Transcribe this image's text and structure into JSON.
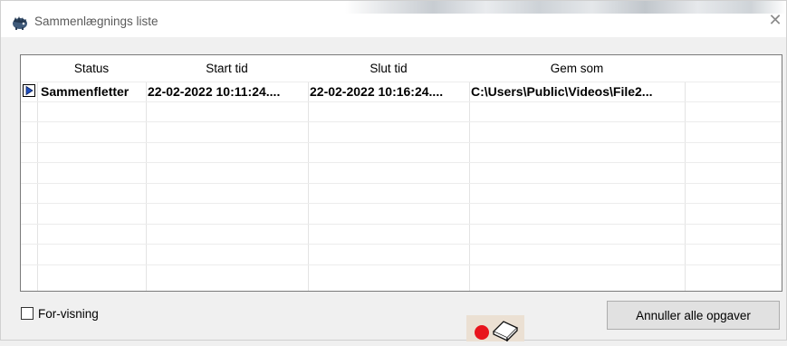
{
  "window": {
    "title": "Sammenlægnings liste",
    "close_glyph": "✕",
    "app_icon": "hedgehog-app-icon"
  },
  "list": {
    "columns": [
      "Status",
      "Start tid",
      "Slut tid",
      "Gem som",
      ""
    ],
    "rows": [
      {
        "indicator_icon": "play-arrow-icon",
        "status": "Sammenfletter",
        "start_tid": "22-02-2022 10:11:24....",
        "slut_tid": "22-02-2022 10:16:24....",
        "gem_som": "C:\\Users\\Public\\Videos\\File2..."
      }
    ]
  },
  "footer": {
    "preview_checkbox_label": "For-visning",
    "preview_checked": false,
    "cancel_button_label": "Annuller alle opgaver",
    "record_icon": "record-dot-icon",
    "eraser_icon": "eraser-icon"
  },
  "colors": {
    "record_red": "#e8141c",
    "indicator_blue": "#1f4fbf"
  }
}
